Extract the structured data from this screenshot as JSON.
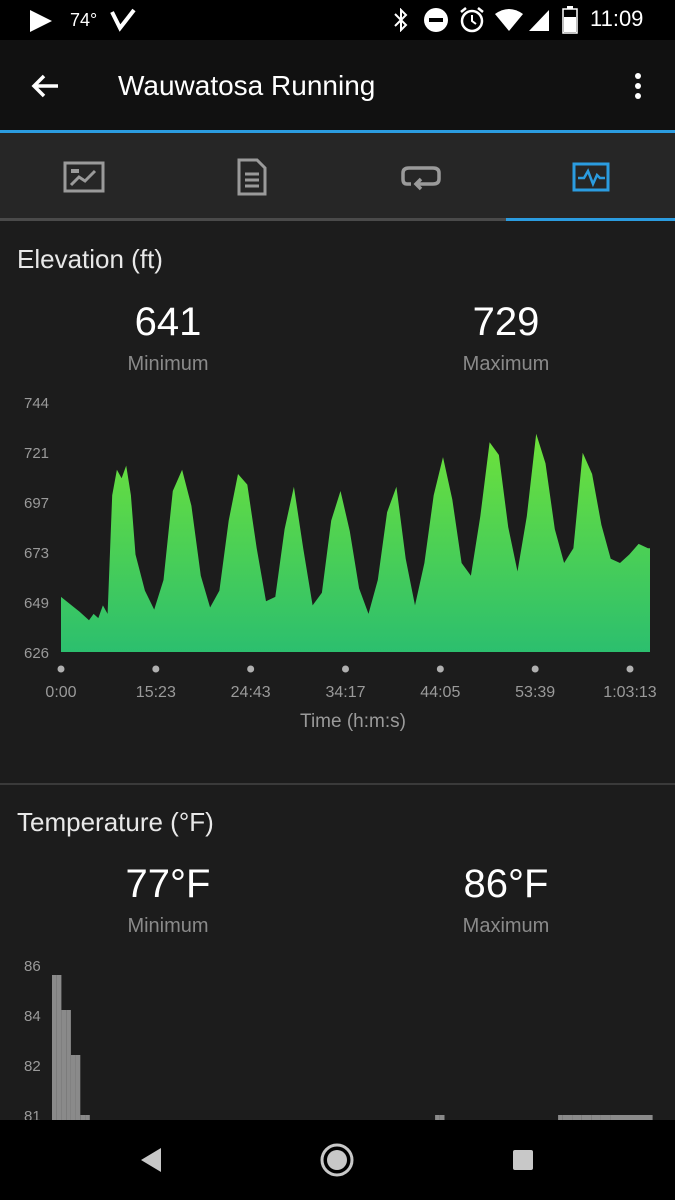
{
  "status_bar": {
    "temperature": "74°",
    "time": "11:09"
  },
  "app_bar": {
    "title": "Wauwatosa Running",
    "back_icon": "arrow-left-icon",
    "menu_icon": "more-vertical-icon"
  },
  "tabs": [
    {
      "icon": "summary-chart-icon",
      "active": false
    },
    {
      "icon": "laps-document-icon",
      "active": false
    },
    {
      "icon": "repeat-loop-icon",
      "active": false
    },
    {
      "icon": "graph-monitor-icon",
      "active": true
    }
  ],
  "colors": {
    "accent": "#2b9ce0",
    "elevation_top": "#6ee23a",
    "elevation_bottom": "#2cbf6e",
    "temperature_fill": "#8a8a8a"
  },
  "elevation": {
    "title": "Elevation (ft)",
    "min_value": "641",
    "min_label": "Minimum",
    "max_value": "729",
    "max_label": "Maximum",
    "xlabel": "Time (h:m:s)"
  },
  "temperature": {
    "title": "Temperature (°F)",
    "min_value": "77°F",
    "min_label": "Minimum",
    "max_value": "86°F",
    "max_label": "Maximum"
  },
  "chart_data": [
    {
      "type": "area",
      "ylabel": "",
      "xlabel": "Time (h:m:s)",
      "ylim": [
        626,
        744
      ],
      "y_ticks": [
        "744",
        "721",
        "697",
        "673",
        "649",
        "626"
      ],
      "x_ticks": [
        "0:00",
        "15:23",
        "24:43",
        "34:17",
        "44:05",
        "53:39",
        "1:03:13"
      ],
      "x_minutes": [
        0,
        2,
        3,
        3.5,
        4,
        4.5,
        5,
        5.5,
        6,
        6.5,
        7,
        7.5,
        8,
        9,
        10,
        11,
        12,
        13,
        14,
        15,
        16,
        17,
        18,
        19,
        20,
        21,
        22,
        23,
        24,
        25,
        26,
        27,
        28,
        29,
        30,
        31,
        32,
        33,
        34,
        35,
        36,
        37,
        38,
        39,
        40,
        41,
        42,
        43,
        44,
        45,
        46,
        47,
        48,
        49,
        50,
        51,
        52,
        53,
        54,
        55,
        56,
        57,
        58,
        59,
        60,
        61,
        62,
        63,
        63.22
      ],
      "y": [
        652,
        645,
        641,
        644,
        642,
        648,
        644,
        700,
        712,
        708,
        714,
        700,
        672,
        655,
        646,
        660,
        702,
        712,
        695,
        662,
        647,
        655,
        688,
        710,
        705,
        675,
        650,
        652,
        684,
        704,
        675,
        648,
        654,
        688,
        702,
        683,
        656,
        644,
        660,
        692,
        704,
        670,
        648,
        668,
        700,
        718,
        698,
        668,
        662,
        690,
        725,
        719,
        685,
        664,
        690,
        729,
        715,
        684,
        668,
        675,
        720,
        710,
        686,
        670,
        668,
        672,
        677,
        675,
        675
      ]
    },
    {
      "type": "bar",
      "ylabel": "",
      "ylim": [
        80.6,
        86
      ],
      "y_ticks": [
        "86",
        "84",
        "82",
        "81"
      ],
      "x_minutes": [
        0,
        0.5,
        1,
        1.5,
        2,
        2.5,
        3,
        3.5,
        40.5,
        41,
        53.5,
        54,
        55,
        56,
        57,
        58,
        59,
        60,
        61,
        62,
        63
      ],
      "y": [
        85.6,
        85.6,
        84.2,
        84.2,
        82.4,
        82.4,
        81,
        81,
        81,
        81,
        81,
        81,
        81,
        81,
        81,
        81,
        81,
        81,
        81,
        81,
        81
      ]
    }
  ]
}
